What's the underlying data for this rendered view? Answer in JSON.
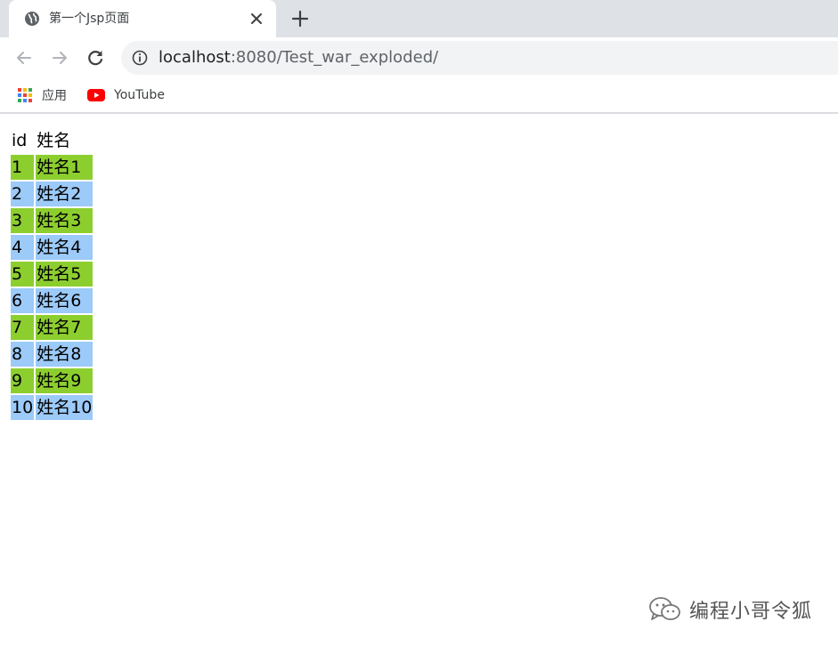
{
  "browser": {
    "tab": {
      "title": "第一个Jsp页面",
      "favicon": "globe-icon",
      "close": "close-icon"
    },
    "new_tab": "plus-icon",
    "nav": {
      "back": "back-arrow-icon",
      "forward": "forward-arrow-icon",
      "reload": "reload-icon"
    },
    "address": {
      "host": "localhost",
      "rest": ":8080/Test_war_exploded/",
      "info_icon": "info-icon"
    },
    "bookmarks": [
      {
        "label": "应用",
        "icon": "apps-grid-icon"
      },
      {
        "label": "YouTube",
        "icon": "youtube-icon"
      }
    ]
  },
  "table": {
    "headers": [
      "id",
      "姓名"
    ],
    "rows": [
      [
        "1",
        "姓名1"
      ],
      [
        "2",
        "姓名2"
      ],
      [
        "3",
        "姓名3"
      ],
      [
        "4",
        "姓名4"
      ],
      [
        "5",
        "姓名5"
      ],
      [
        "6",
        "姓名6"
      ],
      [
        "7",
        "姓名7"
      ],
      [
        "8",
        "姓名8"
      ],
      [
        "9",
        "姓名9"
      ],
      [
        "10",
        "姓名10"
      ]
    ],
    "colors": {
      "odd_row": "#8dce2f",
      "even_row": "#9ccaf9"
    }
  },
  "watermark": {
    "text": "编程小哥令狐",
    "icon": "wechat-icon"
  }
}
